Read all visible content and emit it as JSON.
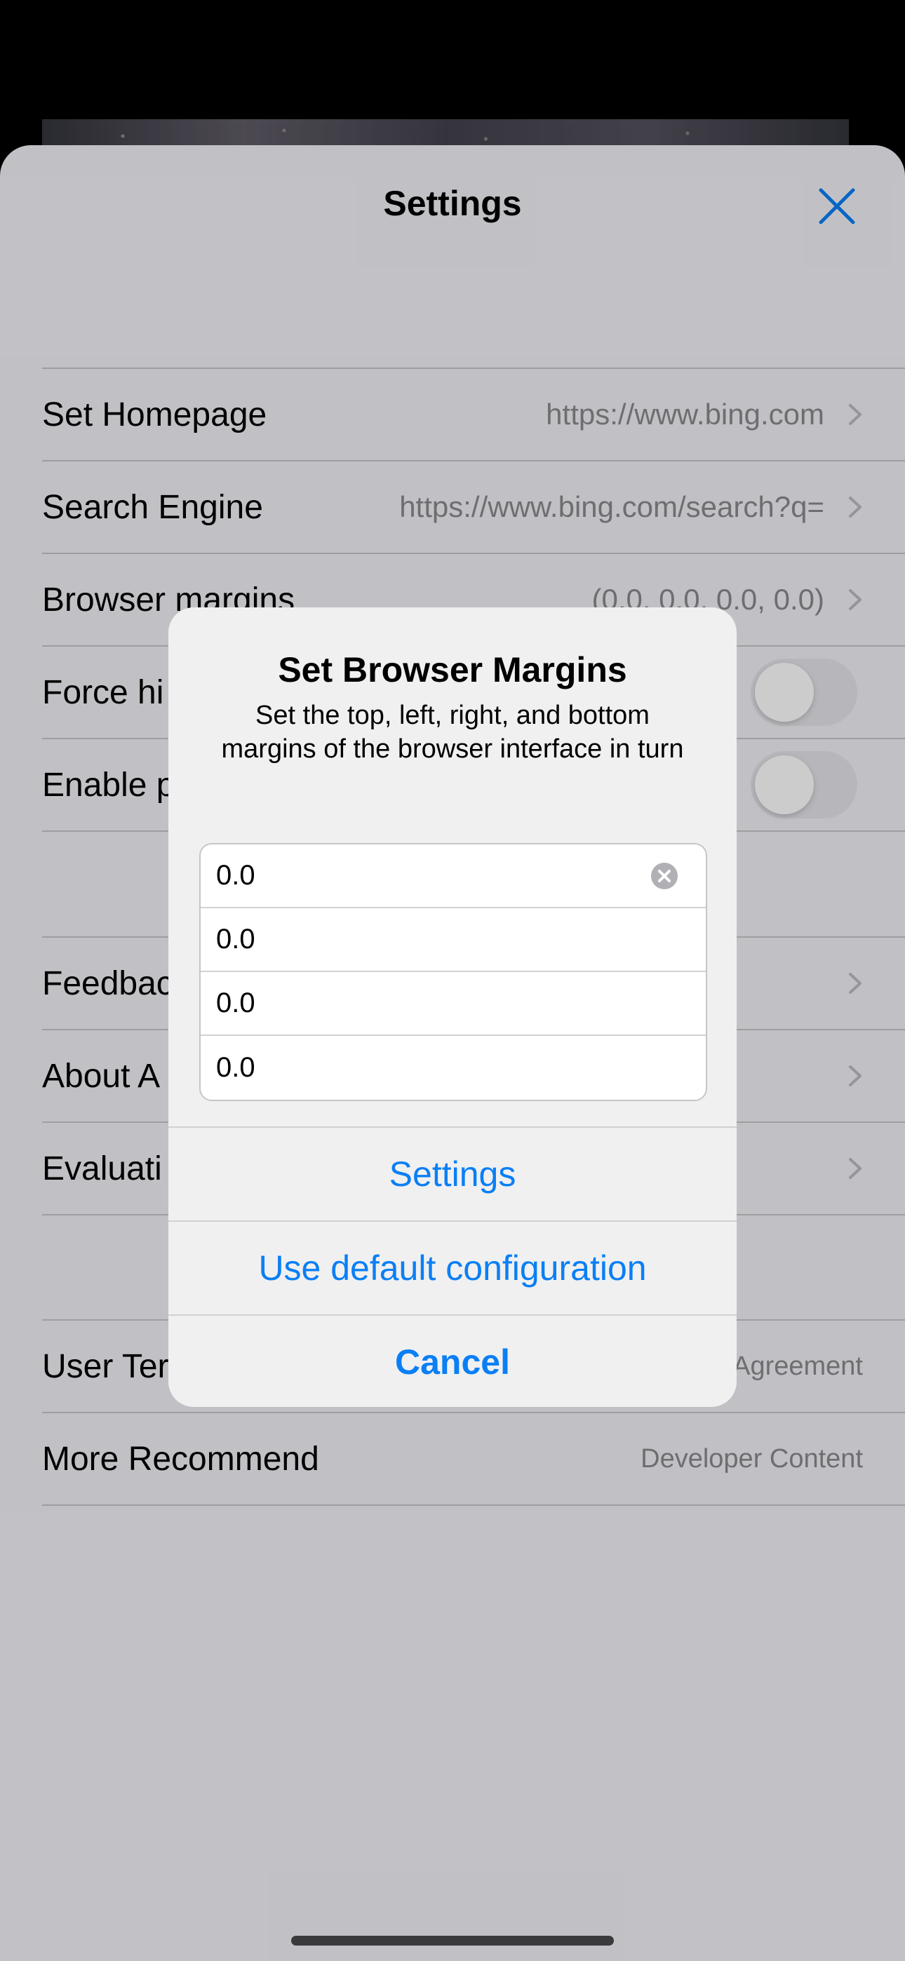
{
  "header": {
    "title": "Settings"
  },
  "settings": {
    "group1": [
      {
        "label": "Set Homepage",
        "value": "https://www.bing.com"
      },
      {
        "label": "Search Engine",
        "value": "https://www.bing.com/search?q="
      },
      {
        "label": "Browser margins",
        "value": "(0.0, 0.0, 0.0, 0.0)"
      },
      {
        "label": "Force hi",
        "toggle_on": false
      },
      {
        "label": "Enable p",
        "toggle_on": false
      }
    ],
    "group2": [
      {
        "label": "Feedbac"
      },
      {
        "label": "About A"
      },
      {
        "label": "Evaluati"
      }
    ],
    "group3": [
      {
        "label": "User Ter",
        "value": "Agreement"
      },
      {
        "label": "More Recommend",
        "value": "Developer Content"
      }
    ]
  },
  "alert": {
    "title": "Set Browser Margins",
    "message": "Set the top, left, right, and bottom margins of the browser interface in turn",
    "fields": [
      "0.0",
      "0.0",
      "0.0",
      "0.0"
    ],
    "actions": {
      "settings": "Settings",
      "use_default": "Use default configuration",
      "cancel": "Cancel"
    }
  },
  "colors": {
    "accent": "#0a7ff5",
    "secondary_text": "#8a8a8e",
    "separator": "#c6c6c8"
  },
  "icons": {
    "close": "close-icon",
    "chevron": "chevron-right-icon",
    "clear": "clear-text-icon"
  }
}
